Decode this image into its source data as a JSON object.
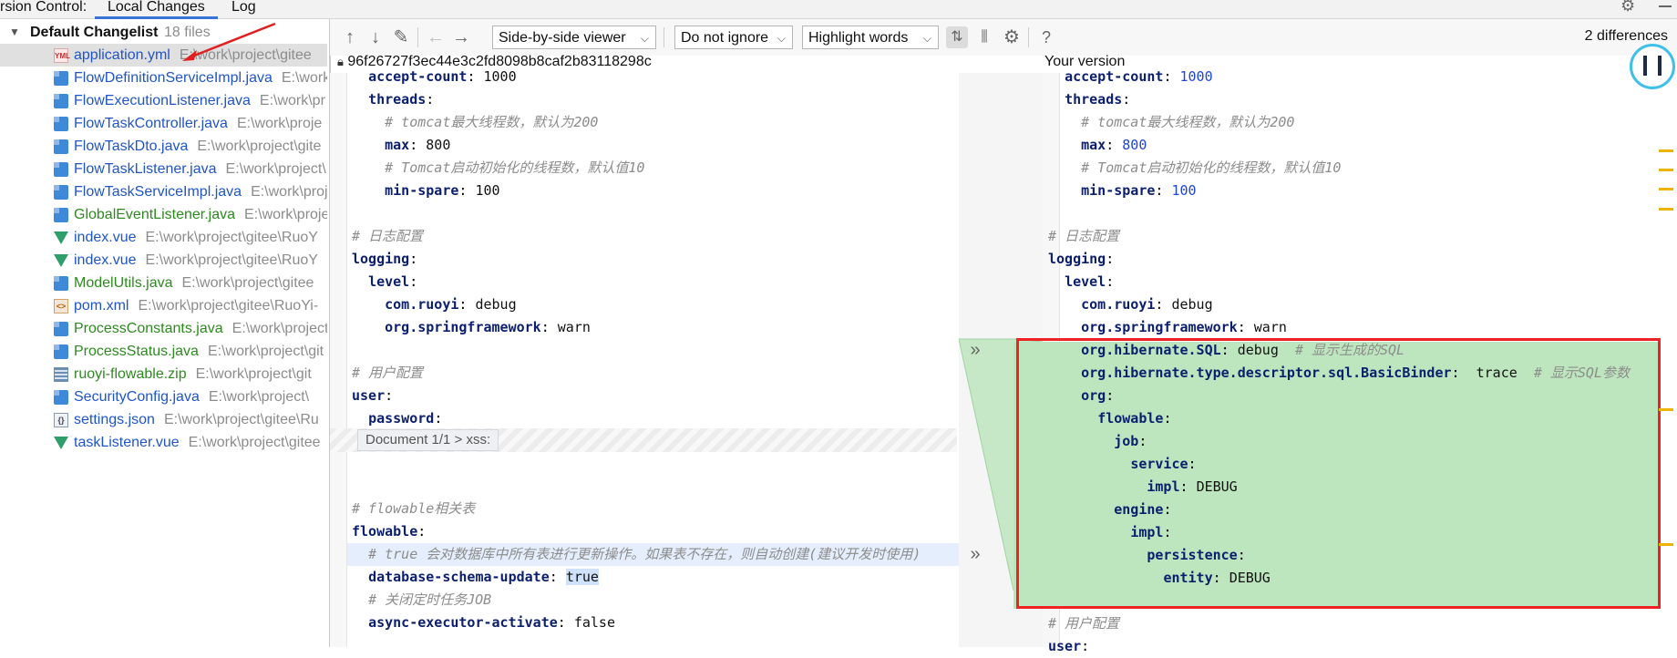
{
  "topbar": {
    "title": "rsion Control:",
    "tabs": [
      "Local Changes",
      "Log"
    ]
  },
  "changelist": {
    "name": "Default Changelist",
    "count": "18 files",
    "files": [
      {
        "name": "application.yml",
        "path": "E:\\work\\project\\gitee",
        "type": "yml",
        "status": "modified"
      },
      {
        "name": "FlowDefinitionServiceImpl.java",
        "path": "E:\\work",
        "type": "java",
        "status": "modified"
      },
      {
        "name": "FlowExecutionListener.java",
        "path": "E:\\work\\pr",
        "type": "java",
        "status": "modified"
      },
      {
        "name": "FlowTaskController.java",
        "path": "E:\\work\\proje",
        "type": "java",
        "status": "modified"
      },
      {
        "name": "FlowTaskDto.java",
        "path": "E:\\work\\project\\gite",
        "type": "java",
        "status": "modified"
      },
      {
        "name": "FlowTaskListener.java",
        "path": "E:\\work\\project\\",
        "type": "java",
        "status": "modified"
      },
      {
        "name": "FlowTaskServiceImpl.java",
        "path": "E:\\work\\proj",
        "type": "java",
        "status": "modified"
      },
      {
        "name": "GlobalEventListener.java",
        "path": "E:\\work\\proje",
        "type": "java",
        "status": "added"
      },
      {
        "name": "index.vue",
        "path": "E:\\work\\project\\gitee\\RuoY",
        "type": "vue",
        "status": "modified"
      },
      {
        "name": "index.vue",
        "path": "E:\\work\\project\\gitee\\RuoY",
        "type": "vue",
        "status": "modified"
      },
      {
        "name": "ModelUtils.java",
        "path": "E:\\work\\project\\gitee",
        "type": "java",
        "status": "added"
      },
      {
        "name": "pom.xml",
        "path": "E:\\work\\project\\gitee\\RuoYi-",
        "type": "xml",
        "status": "modified"
      },
      {
        "name": "ProcessConstants.java",
        "path": "E:\\work\\project",
        "type": "java",
        "status": "added"
      },
      {
        "name": "ProcessStatus.java",
        "path": "E:\\work\\project\\git",
        "type": "java",
        "status": "added"
      },
      {
        "name": "ruoyi-flowable.zip",
        "path": "E:\\work\\project\\git",
        "type": "zip",
        "status": "added"
      },
      {
        "name": "SecurityConfig.java",
        "path": "E:\\work\\project\\",
        "type": "java",
        "status": "modified"
      },
      {
        "name": "settings.json",
        "path": "E:\\work\\project\\gitee\\Ru",
        "type": "json",
        "status": "modified"
      },
      {
        "name": "taskListener.vue",
        "path": "E:\\work\\project\\gitee",
        "type": "vue",
        "status": "modified"
      }
    ]
  },
  "toolbar": {
    "viewer": "Side-by-side viewer",
    "whitespace": "Do not ignore",
    "highlight": "Highlight words",
    "differences": "2 differences"
  },
  "diff": {
    "left_title": "96f26727f3ec44e3c2fd8098b8caf2b83118298c",
    "right_title": "Your version",
    "fold_label": "Document 1/1 > xss:",
    "left_lines": [
      {
        "key": "accept-count",
        "indent": "  ",
        "value": "1000"
      },
      {
        "key": "threads",
        "indent": "  ",
        "value": ""
      },
      {
        "comment": "# tomcat最大线程数，默认为200",
        "indent": "    "
      },
      {
        "key": "max",
        "indent": "    ",
        "value": "800"
      },
      {
        "comment": "# Tomcat启动初始化的线程数，默认值10",
        "indent": "    "
      },
      {
        "key": "min-spare",
        "indent": "    ",
        "value": "100"
      },
      {
        "blank": true
      },
      {
        "comment": "# 日志配置",
        "indent": ""
      },
      {
        "key": "logging",
        "indent": "",
        "value": ""
      },
      {
        "key": "level",
        "indent": "  ",
        "value": ""
      },
      {
        "key": "com.ruoyi",
        "indent": "    ",
        "value": "debug"
      },
      {
        "key": "org.springframework",
        "indent": "    ",
        "value": "warn"
      },
      {
        "blank": true
      },
      {
        "comment": "# 用户配置",
        "indent": ""
      },
      {
        "key": "user",
        "indent": "",
        "value": ""
      },
      {
        "key": "password",
        "indent": "  ",
        "value": ""
      }
    ],
    "left_lines_lower": [
      {
        "blank": true
      },
      {
        "comment": "# flowable相关表",
        "indent": ""
      },
      {
        "key": "flowable",
        "indent": "",
        "value": ""
      },
      {
        "comment": "# true 会对数据库中所有表进行更新操作。如果表不存在，则自动创建(建议开发时使用)",
        "indent": "  "
      },
      {
        "key": "database-schema-update",
        "indent": "  ",
        "value": "true"
      },
      {
        "comment": "# 关闭定时任务JOB",
        "indent": "  "
      },
      {
        "key": "async-executor-activate",
        "indent": "  ",
        "value": "false"
      }
    ],
    "right_lines": [
      {
        "key": "accept-count",
        "indent": "  ",
        "value": "1000"
      },
      {
        "key": "threads",
        "indent": "  ",
        "value": ""
      },
      {
        "comment": "# tomcat最大线程数，默认为200",
        "indent": "    "
      },
      {
        "key": "max",
        "indent": "    ",
        "value": "800"
      },
      {
        "comment": "# Tomcat启动初始化的线程数，默认值10",
        "indent": "    "
      },
      {
        "key": "min-spare",
        "indent": "    ",
        "value": "100"
      },
      {
        "blank": true
      },
      {
        "comment": "# 日志配置",
        "indent": ""
      },
      {
        "key": "logging",
        "indent": "",
        "value": ""
      },
      {
        "key": "level",
        "indent": "  ",
        "value": ""
      },
      {
        "key": "com.ruoyi",
        "indent": "    ",
        "value": "debug"
      },
      {
        "key": "org.springframework",
        "indent": "    ",
        "value": "warn"
      },
      {
        "key": "org.hibernate.SQL",
        "indent": "    ",
        "value": "debug",
        "comment": "# 显示生成的SQL"
      },
      {
        "key": "org.hibernate.type.descriptor.sql.BasicBinder",
        "indent": "    ",
        "value": " trace",
        "comment": "# 显示SQL参数"
      },
      {
        "key": "org",
        "indent": "    ",
        "value": ""
      },
      {
        "key": "flowable",
        "indent": "      ",
        "value": ""
      },
      {
        "key": "job",
        "indent": "        ",
        "value": ""
      },
      {
        "key": "service",
        "indent": "          ",
        "value": ""
      },
      {
        "key": "impl",
        "indent": "            ",
        "value": "DEBUG"
      },
      {
        "key": "engine",
        "indent": "        ",
        "value": ""
      },
      {
        "key": "impl",
        "indent": "          ",
        "value": ""
      },
      {
        "key": "persistence",
        "indent": "            ",
        "value": ""
      },
      {
        "key": "entity",
        "indent": "              ",
        "value": "DEBUG"
      },
      {
        "blank": true
      },
      {
        "comment": "# 用户配置",
        "indent": ""
      },
      {
        "key": "user",
        "indent": "",
        "value": ""
      }
    ]
  },
  "colors": {
    "added": "#bde6be",
    "modified_line": "#e5eefc",
    "highlight_box": "#ee2222",
    "key": "#0b1f6e",
    "changed_value": "#1f45d6",
    "comment": "#8c8c8c"
  }
}
